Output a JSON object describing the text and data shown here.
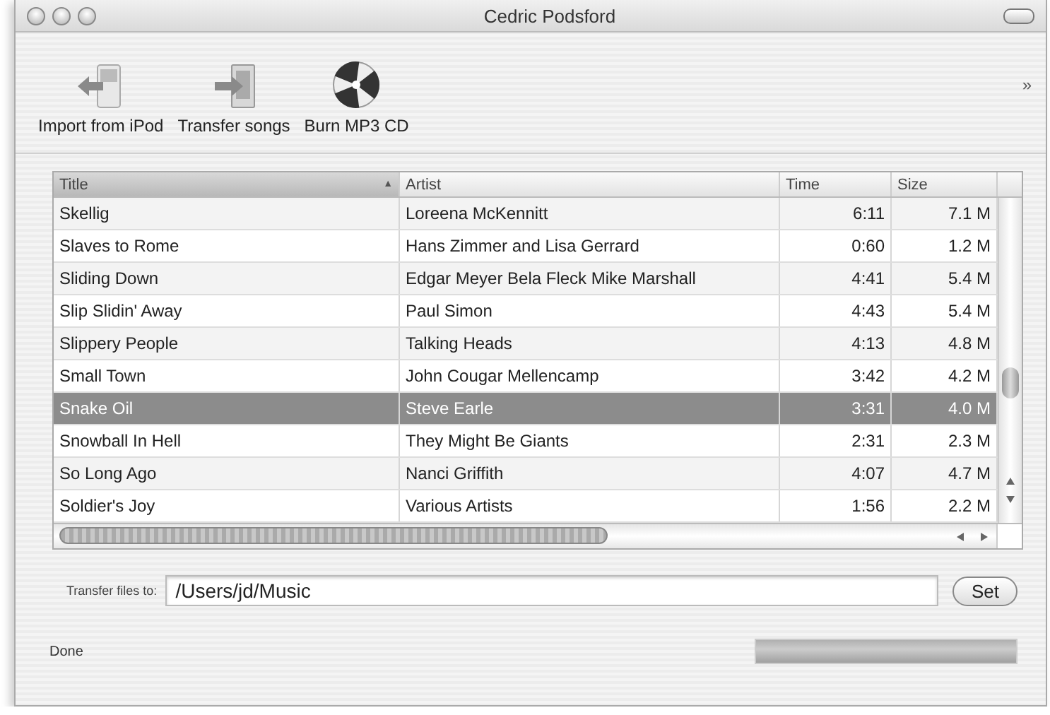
{
  "window": {
    "title": "Cedric Podsford"
  },
  "toolbar": {
    "items": [
      {
        "label": "Import from iPod",
        "kind": "import"
      },
      {
        "label": "Transfer songs",
        "kind": "transfer"
      },
      {
        "label": "Burn MP3 CD",
        "kind": "burn"
      }
    ],
    "overflow": "»"
  },
  "table": {
    "columns": [
      {
        "label": "Title",
        "sorted": true,
        "sort_indicator": "▲",
        "kind": "text"
      },
      {
        "label": "Artist",
        "sorted": false,
        "kind": "text"
      },
      {
        "label": "Time",
        "sorted": false,
        "kind": "number"
      },
      {
        "label": "Size",
        "sorted": false,
        "kind": "number"
      }
    ],
    "rows": [
      {
        "cells": [
          "Skellig",
          "Loreena McKennitt",
          "6:11",
          "7.1 M"
        ],
        "selected": false
      },
      {
        "cells": [
          "Slaves to Rome",
          "Hans Zimmer and Lisa Gerrard",
          "0:60",
          "1.2 M"
        ],
        "selected": false
      },
      {
        "cells": [
          "Sliding Down",
          "Edgar Meyer Bela Fleck Mike Marshall",
          "4:41",
          "5.4 M"
        ],
        "selected": false
      },
      {
        "cells": [
          "Slip Slidin' Away",
          "Paul Simon",
          "4:43",
          "5.4 M"
        ],
        "selected": false
      },
      {
        "cells": [
          "Slippery People",
          "Talking Heads",
          "4:13",
          "4.8 M"
        ],
        "selected": false
      },
      {
        "cells": [
          "Small Town",
          "John Cougar Mellencamp",
          "3:42",
          "4.2 M"
        ],
        "selected": false
      },
      {
        "cells": [
          "Snake Oil",
          "Steve Earle",
          "3:31",
          "4.0 M"
        ],
        "selected": true
      },
      {
        "cells": [
          "Snowball In Hell",
          "They Might Be Giants",
          "2:31",
          "2.3 M"
        ],
        "selected": false
      },
      {
        "cells": [
          "So Long Ago",
          "Nanci Griffith",
          "4:07",
          "4.7 M"
        ],
        "selected": false
      },
      {
        "cells": [
          "Soldier's Joy",
          "Various Artists",
          "1:56",
          "2.2 M"
        ],
        "selected": false
      }
    ]
  },
  "transfer": {
    "label": "Transfer files to:",
    "value": "/Users/jd/Music",
    "button": "Set"
  },
  "status_bar": {
    "text": "Done",
    "progress": {
      "level": 1
    }
  }
}
